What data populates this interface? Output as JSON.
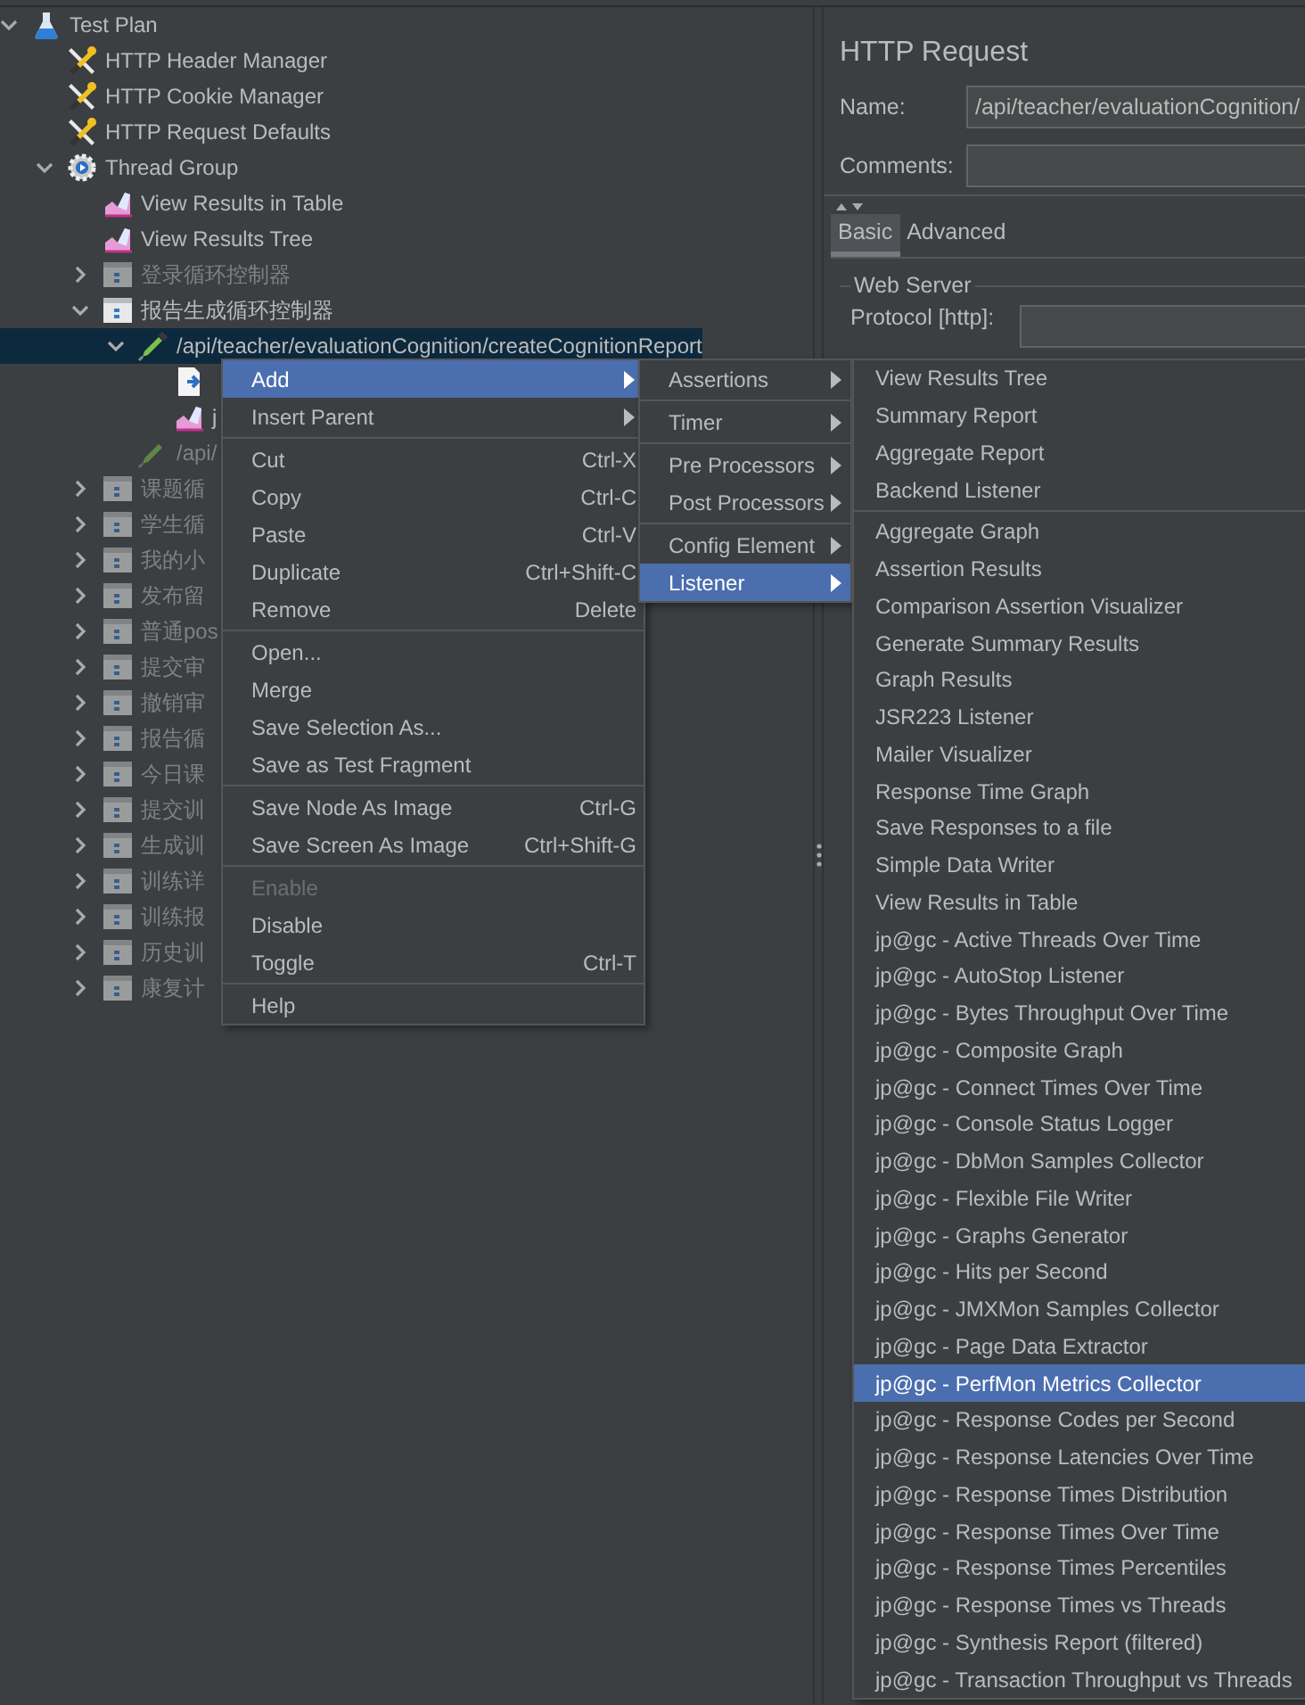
{
  "tree": [
    {
      "label": "Test Plan",
      "kind": "test-plan",
      "expanded": true,
      "selected": false,
      "disabled": false,
      "children": [
        {
          "label": "HTTP Header Manager",
          "kind": "config",
          "selected": false,
          "disabled": false
        },
        {
          "label": "HTTP Cookie Manager",
          "kind": "config",
          "selected": false,
          "disabled": false
        },
        {
          "label": "HTTP Request Defaults",
          "kind": "config",
          "selected": false,
          "disabled": false
        },
        {
          "label": "Thread Group",
          "kind": "thread-group",
          "expanded": true,
          "selected": false,
          "disabled": false,
          "children": [
            {
              "label": "View Results in Table",
              "kind": "listener",
              "selected": false,
              "disabled": false
            },
            {
              "label": "View Results Tree",
              "kind": "listener",
              "selected": false,
              "disabled": false
            },
            {
              "label": "登录循环控制器",
              "kind": "controller",
              "expanded": false,
              "selected": false,
              "disabled": true
            },
            {
              "label": "报告生成循环控制器",
              "kind": "controller",
              "expanded": true,
              "selected": false,
              "disabled": false,
              "children": [
                {
                  "label": "/api/teacher/evaluationCognition/createCognitionReport",
                  "kind": "sampler",
                  "expanded": true,
                  "selected": true,
                  "disabled": false,
                  "children": [
                    {
                      "kind": "script",
                      "selected": false,
                      "disabled": false
                    },
                    {
                      "label": "j",
                      "kind": "listener",
                      "selected": false,
                      "disabled": false
                    }
                  ]
                },
                {
                  "label": "/api/",
                  "kind": "sampler",
                  "selected": false,
                  "disabled": true
                }
              ]
            },
            {
              "label": "课题循",
              "kind": "controller",
              "expanded": false,
              "selected": false,
              "disabled": true
            },
            {
              "label": "学生循",
              "kind": "controller",
              "expanded": false,
              "selected": false,
              "disabled": true
            },
            {
              "label": "我的小",
              "kind": "controller",
              "expanded": false,
              "selected": false,
              "disabled": true
            },
            {
              "label": "发布留",
              "kind": "controller",
              "expanded": false,
              "selected": false,
              "disabled": true
            },
            {
              "label": "普通pos",
              "kind": "controller",
              "expanded": false,
              "selected": false,
              "disabled": true
            },
            {
              "label": "提交审",
              "kind": "controller",
              "expanded": false,
              "selected": false,
              "disabled": true
            },
            {
              "label": "撤销审",
              "kind": "controller",
              "expanded": false,
              "selected": false,
              "disabled": true
            },
            {
              "label": "报告循",
              "kind": "controller",
              "expanded": false,
              "selected": false,
              "disabled": true
            },
            {
              "label": "今日课",
              "kind": "controller",
              "expanded": false,
              "selected": false,
              "disabled": true
            },
            {
              "label": "提交训",
              "kind": "controller",
              "expanded": false,
              "selected": false,
              "disabled": true
            },
            {
              "label": "生成训",
              "kind": "controller",
              "expanded": false,
              "selected": false,
              "disabled": true
            },
            {
              "label": "训练详",
              "kind": "controller",
              "expanded": false,
              "selected": false,
              "disabled": true
            },
            {
              "label": "训练报",
              "kind": "controller",
              "expanded": false,
              "selected": false,
              "disabled": true
            },
            {
              "label": "历史训",
              "kind": "controller",
              "expanded": false,
              "selected": false,
              "disabled": true
            },
            {
              "label": "康复计",
              "kind": "controller",
              "expanded": false,
              "selected": false,
              "disabled": true
            }
          ]
        }
      ]
    }
  ],
  "panel": {
    "title": "HTTP Request",
    "name_label": "Name:",
    "name_value": "/api/teacher/evaluationCognition/",
    "comments_label": "Comments:",
    "tabs": [
      {
        "label": "Basic",
        "selected": true
      },
      {
        "label": "Advanced",
        "selected": false
      }
    ],
    "group_title": "Web Server",
    "protocol_label": "Protocol [http]:"
  },
  "context_menu": [
    {
      "kind": "item",
      "label": "Add",
      "submenu": true,
      "selected": true,
      "disabled": false
    },
    {
      "kind": "item",
      "label": "Insert Parent",
      "submenu": true,
      "selected": false,
      "disabled": false
    },
    {
      "kind": "separator"
    },
    {
      "kind": "item",
      "label": "Cut",
      "shortcut": "Ctrl-X",
      "selected": false,
      "disabled": false
    },
    {
      "kind": "item",
      "label": "Copy",
      "shortcut": "Ctrl-C",
      "selected": false,
      "disabled": false
    },
    {
      "kind": "item",
      "label": "Paste",
      "shortcut": "Ctrl-V",
      "selected": false,
      "disabled": false
    },
    {
      "kind": "item",
      "label": "Duplicate",
      "shortcut": "Ctrl+Shift-C",
      "selected": false,
      "disabled": false
    },
    {
      "kind": "item",
      "label": "Remove",
      "shortcut": "Delete",
      "selected": false,
      "disabled": false
    },
    {
      "kind": "separator"
    },
    {
      "kind": "item",
      "label": "Open...",
      "selected": false,
      "disabled": false
    },
    {
      "kind": "item",
      "label": "Merge",
      "selected": false,
      "disabled": false
    },
    {
      "kind": "item",
      "label": "Save Selection As...",
      "selected": false,
      "disabled": false
    },
    {
      "kind": "item",
      "label": "Save as Test Fragment",
      "selected": false,
      "disabled": false
    },
    {
      "kind": "separator"
    },
    {
      "kind": "item",
      "label": "Save Node As Image",
      "shortcut": "Ctrl-G",
      "selected": false,
      "disabled": false
    },
    {
      "kind": "item",
      "label": "Save Screen As Image",
      "shortcut": "Ctrl+Shift-G",
      "selected": false,
      "disabled": false
    },
    {
      "kind": "separator"
    },
    {
      "kind": "item",
      "label": "Enable",
      "selected": false,
      "disabled": true
    },
    {
      "kind": "item",
      "label": "Disable",
      "selected": false,
      "disabled": false
    },
    {
      "kind": "item",
      "label": "Toggle",
      "shortcut": "Ctrl-T",
      "selected": false,
      "disabled": false
    },
    {
      "kind": "separator"
    },
    {
      "kind": "item",
      "label": "Help",
      "selected": false,
      "disabled": false
    }
  ],
  "add_menu": [
    {
      "kind": "item",
      "label": "Assertions",
      "submenu": true,
      "selected": false,
      "disabled": false
    },
    {
      "kind": "separator"
    },
    {
      "kind": "item",
      "label": "Timer",
      "submenu": true,
      "selected": false,
      "disabled": false
    },
    {
      "kind": "separator"
    },
    {
      "kind": "item",
      "label": "Pre Processors",
      "submenu": true,
      "selected": false,
      "disabled": false
    },
    {
      "kind": "item",
      "label": "Post Processors",
      "submenu": true,
      "selected": false,
      "disabled": false
    },
    {
      "kind": "separator"
    },
    {
      "kind": "item",
      "label": "Config Element",
      "submenu": true,
      "selected": false,
      "disabled": false
    },
    {
      "kind": "item",
      "label": "Listener",
      "submenu": true,
      "selected": true,
      "disabled": false
    }
  ],
  "listener_menu": [
    {
      "kind": "item",
      "label": "View Results Tree",
      "selected": false,
      "disabled": false
    },
    {
      "kind": "item",
      "label": "Summary Report",
      "selected": false,
      "disabled": false
    },
    {
      "kind": "item",
      "label": "Aggregate Report",
      "selected": false,
      "disabled": false
    },
    {
      "kind": "item",
      "label": "Backend Listener",
      "selected": false,
      "disabled": false
    },
    {
      "kind": "separator"
    },
    {
      "kind": "item",
      "label": "Aggregate Graph",
      "selected": false,
      "disabled": false
    },
    {
      "kind": "item",
      "label": "Assertion Results",
      "selected": false,
      "disabled": false
    },
    {
      "kind": "item",
      "label": "Comparison Assertion Visualizer",
      "selected": false,
      "disabled": false
    },
    {
      "kind": "item",
      "label": "Generate Summary Results",
      "selected": false,
      "disabled": false
    },
    {
      "kind": "item",
      "label": "Graph Results",
      "selected": false,
      "disabled": false
    },
    {
      "kind": "item",
      "label": "JSR223 Listener",
      "selected": false,
      "disabled": false
    },
    {
      "kind": "item",
      "label": "Mailer Visualizer",
      "selected": false,
      "disabled": false
    },
    {
      "kind": "item",
      "label": "Response Time Graph",
      "selected": false,
      "disabled": false
    },
    {
      "kind": "item",
      "label": "Save Responses to a file",
      "selected": false,
      "disabled": false
    },
    {
      "kind": "item",
      "label": "Simple Data Writer",
      "selected": false,
      "disabled": false
    },
    {
      "kind": "item",
      "label": "View Results in Table",
      "selected": false,
      "disabled": false
    },
    {
      "kind": "item",
      "label": "jp@gc - Active Threads Over Time",
      "selected": false,
      "disabled": false
    },
    {
      "kind": "item",
      "label": "jp@gc - AutoStop Listener",
      "selected": false,
      "disabled": false
    },
    {
      "kind": "item",
      "label": "jp@gc - Bytes Throughput Over Time",
      "selected": false,
      "disabled": false
    },
    {
      "kind": "item",
      "label": "jp@gc - Composite Graph",
      "selected": false,
      "disabled": false
    },
    {
      "kind": "item",
      "label": "jp@gc - Connect Times Over Time",
      "selected": false,
      "disabled": false
    },
    {
      "kind": "item",
      "label": "jp@gc - Console Status Logger",
      "selected": false,
      "disabled": false
    },
    {
      "kind": "item",
      "label": "jp@gc - DbMon Samples Collector",
      "selected": false,
      "disabled": false
    },
    {
      "kind": "item",
      "label": "jp@gc - Flexible File Writer",
      "selected": false,
      "disabled": false
    },
    {
      "kind": "item",
      "label": "jp@gc - Graphs Generator",
      "selected": false,
      "disabled": false
    },
    {
      "kind": "item",
      "label": "jp@gc - Hits per Second",
      "selected": false,
      "disabled": false
    },
    {
      "kind": "item",
      "label": "jp@gc - JMXMon Samples Collector",
      "selected": false,
      "disabled": false
    },
    {
      "kind": "item",
      "label": "jp@gc - Page Data Extractor",
      "selected": false,
      "disabled": false
    },
    {
      "kind": "item",
      "label": "jp@gc - PerfMon Metrics Collector",
      "selected": true,
      "disabled": false
    },
    {
      "kind": "item",
      "label": "jp@gc - Response Codes per Second",
      "selected": false,
      "disabled": false
    },
    {
      "kind": "item",
      "label": "jp@gc - Response Latencies Over Time",
      "selected": false,
      "disabled": false
    },
    {
      "kind": "item",
      "label": "jp@gc - Response Times Distribution",
      "selected": false,
      "disabled": false
    },
    {
      "kind": "item",
      "label": "jp@gc - Response Times Over Time",
      "selected": false,
      "disabled": false
    },
    {
      "kind": "item",
      "label": "jp@gc - Response Times Percentiles",
      "selected": false,
      "disabled": false
    },
    {
      "kind": "item",
      "label": "jp@gc - Response Times vs Threads",
      "selected": false,
      "disabled": false
    },
    {
      "kind": "item",
      "label": "jp@gc - Synthesis Report (filtered)",
      "selected": false,
      "disabled": false
    },
    {
      "kind": "item",
      "label": "jp@gc - Transaction Throughput vs Threads",
      "selected": false,
      "disabled": false
    }
  ]
}
